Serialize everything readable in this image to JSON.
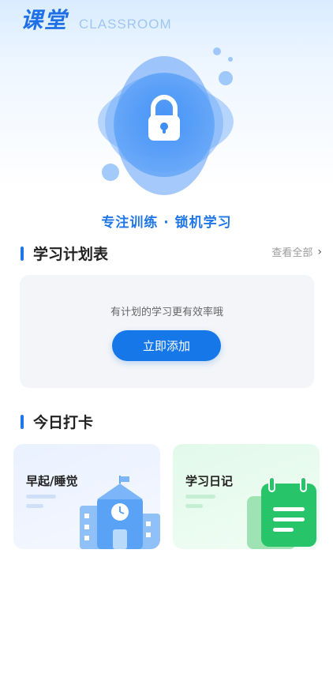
{
  "header": {
    "title": "课堂",
    "subtitle": "CLASSROOM"
  },
  "hero": {
    "slogan": "专注训练 · 锁机学习",
    "icon": "lock-icon"
  },
  "plan": {
    "section_title": "学习计划表",
    "view_all": "查看全部",
    "empty_hint": "有计划的学习更有效率哦",
    "add_label": "立即添加"
  },
  "checkin": {
    "section_title": "今日打卡",
    "cards": [
      {
        "label": "早起/睡觉",
        "icon": "school-building-icon"
      },
      {
        "label": "学习日记",
        "icon": "notebook-icon"
      }
    ]
  },
  "colors": {
    "accent": "#1677e8",
    "title": "#1f6fe5"
  }
}
